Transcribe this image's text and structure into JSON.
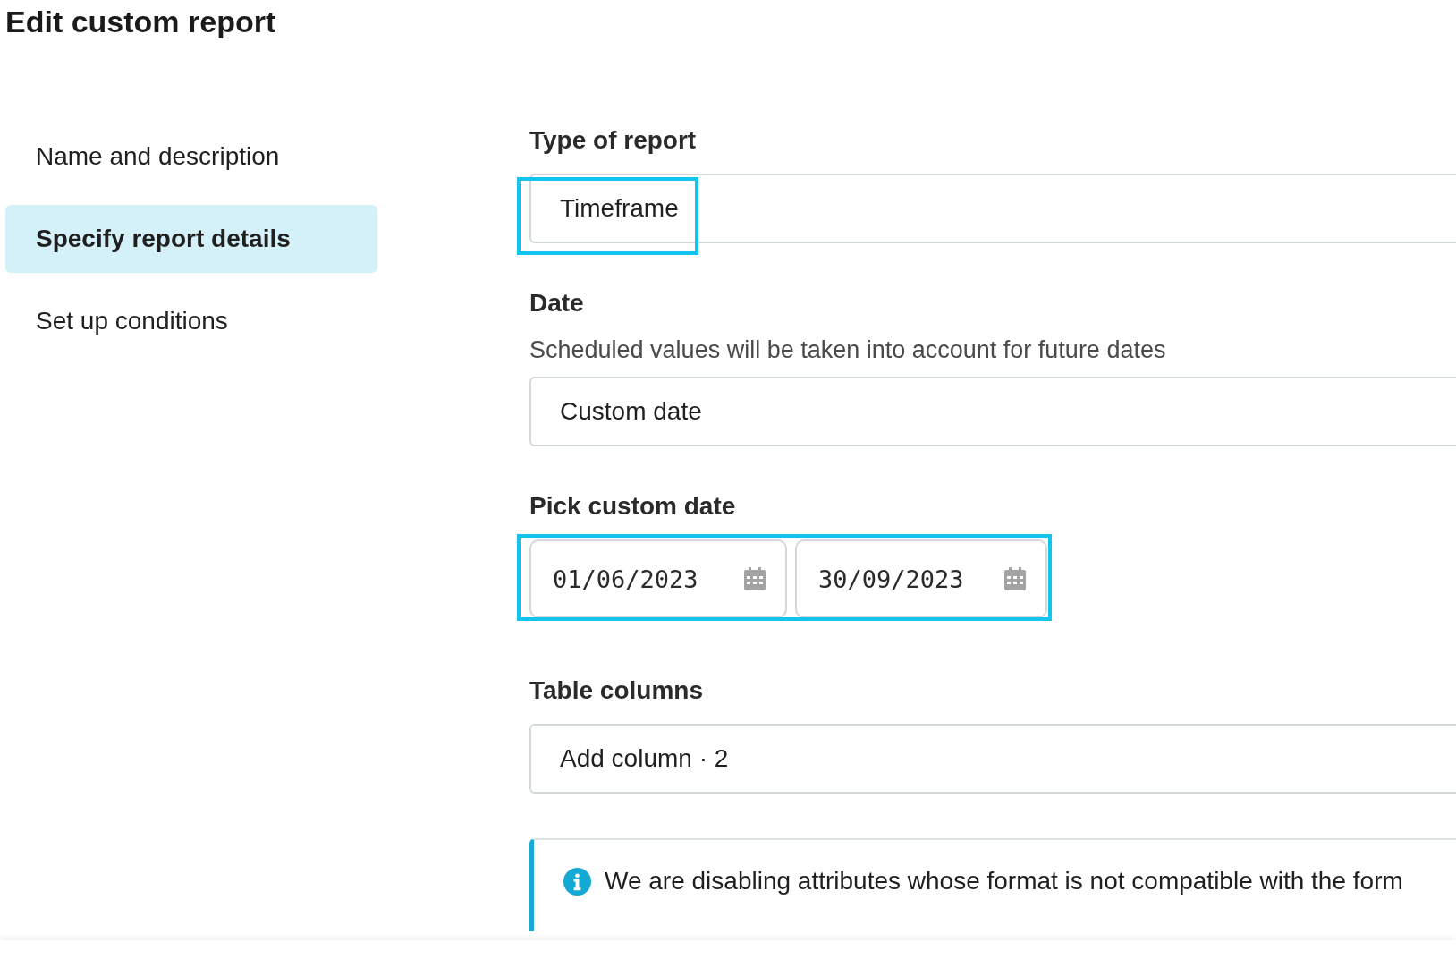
{
  "title": "Edit custom report",
  "steps": [
    {
      "label": "Name and description",
      "selected": false
    },
    {
      "label": "Specify report details",
      "selected": true
    },
    {
      "label": "Set up conditions",
      "selected": false
    }
  ],
  "type_of_report": {
    "label": "Type of report",
    "value": "Timeframe",
    "highlighted": true
  },
  "date": {
    "label": "Date",
    "hint": "Scheduled values will be taken into account for future dates",
    "value": "Custom date"
  },
  "custom_date": {
    "label": "Pick custom date",
    "from": "01/06/2023",
    "to": "30/09/2023",
    "highlighted": true
  },
  "table_columns": {
    "label": "Table columns",
    "value": "Add column · 2"
  },
  "notice": {
    "text": "We are disabling attributes whose format is not compatible with the form"
  }
}
